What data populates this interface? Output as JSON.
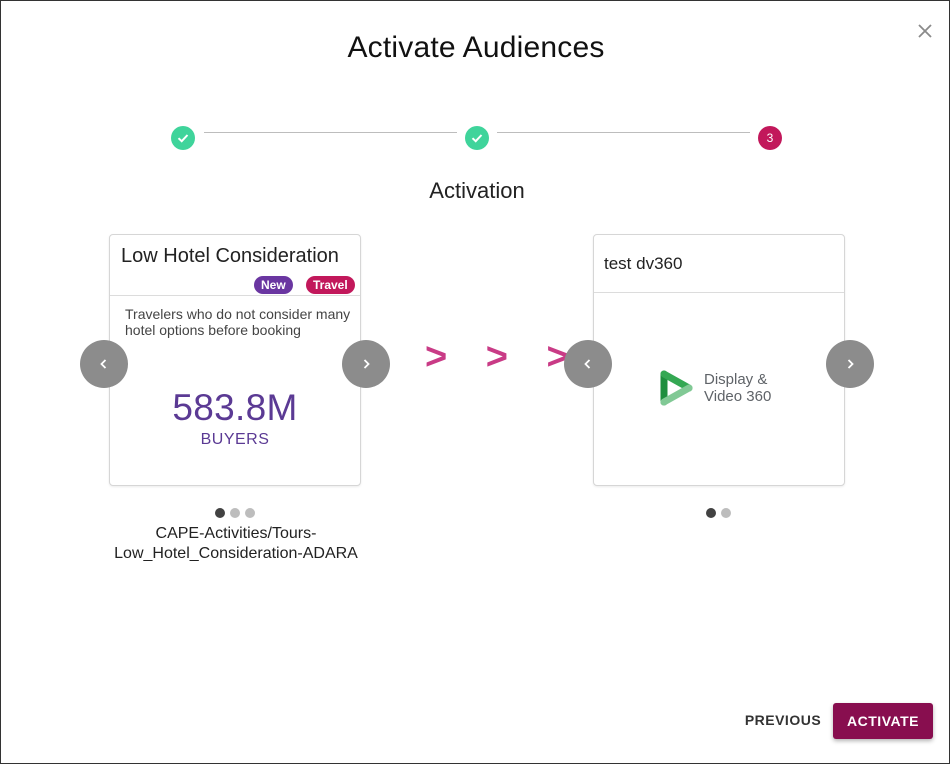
{
  "dialog": {
    "title": "Activate Audiences",
    "close_icon": "close-icon"
  },
  "stepper": {
    "steps": [
      {
        "state": "done",
        "icon": "check-icon"
      },
      {
        "state": "done",
        "icon": "check-icon"
      },
      {
        "state": "active",
        "label": "3"
      }
    ],
    "done_color": "#3fd49b",
    "active_color": "#c2185b"
  },
  "section_title": "Activation",
  "audience_card": {
    "title": "Low Hotel Consideration",
    "badges": [
      {
        "label": "New",
        "color": "#6a36a1"
      },
      {
        "label": "Travel",
        "color": "#c2185b"
      }
    ],
    "description": "Travelers who do not consider many hotel options before booking",
    "metric_value": "583.8M",
    "metric_label": "BUYERS",
    "metric_color": "#5b3a94",
    "segment_name": "CAPE-Activities/Tours-Low_Hotel_Consideration-ADARA",
    "pagination_total": 3,
    "pagination_active": 1
  },
  "arrows": "> > >",
  "destination_card": {
    "title": "test dv360",
    "logo_icon": "display-video-360-icon",
    "logo_text_line1": "Display &",
    "logo_text_line2": "Video 360",
    "pagination_total": 2,
    "pagination_active": 1
  },
  "footer": {
    "previous_label": "PREVIOUS",
    "activate_label": "ACTIVATE",
    "activate_color": "#880e4f"
  }
}
